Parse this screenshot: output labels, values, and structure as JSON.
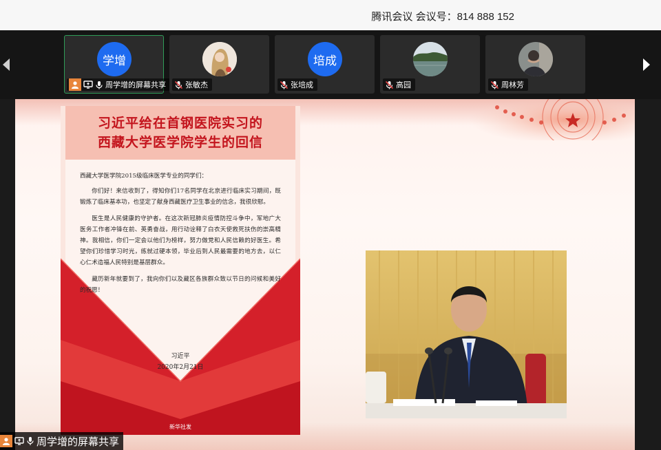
{
  "window": {
    "meeting_title": "腾讯会议 会议号：814 888 152"
  },
  "participants": [
    {
      "name": "周学增的屏幕共享",
      "avatar_text": "学增",
      "avatar_type": "initials",
      "active": true,
      "is_host": true,
      "is_sharing": true
    },
    {
      "name": "张敏杰",
      "avatar_type": "photo-portrait",
      "muted": true
    },
    {
      "name": "张培成",
      "avatar_text": "培成",
      "avatar_type": "initials",
      "muted": true
    },
    {
      "name": "高园",
      "avatar_type": "photo-landscape",
      "muted": true
    },
    {
      "name": "周林芳",
      "avatar_type": "photo-person",
      "muted": true
    }
  ],
  "share_label": "周学增的屏幕共享",
  "slide": {
    "letter": {
      "title_line1": "习近平给在首钢医院实习的",
      "title_line2": "西藏大学医学院学生的回信",
      "salutation": "西藏大学医学院2015级临床医学专业的同学们：",
      "paragraphs": [
        "你们好！来信收到了，得知你们17名同学在北京进行临床实习期间，既锻炼了临床基本功，也坚定了献身西藏医疗卫生事业的信念，我很欣慰。",
        "医生是人民健康的守护者。在这次新冠肺炎疫情防控斗争中，军地广大医务工作者冲锋在前、英勇奋战，用行动诠释了白衣天使救死扶伤的崇高精神。我相信，你们一定会以他们为榜样，努力做党和人民信赖的好医生。希望你们珍惜学习时光，练就过硬本领，毕业后到人民最需要的地方去，以仁心仁术造福人民特别是基层群众。",
        "藏历新年就要到了，我向你们以及藏区各族群众致以节日的问候和美好的祝愿！"
      ],
      "signature_name": "习近平",
      "signature_date": "2020年2月21日",
      "publisher": "新华社发"
    }
  },
  "colors": {
    "active_border": "#2f9d58",
    "avatar_blue": "#1e6bf0",
    "title_red": "#c3141d",
    "envelope_red": "#d4202a",
    "host_orange": "#e8853a"
  },
  "icons": [
    "chevron-left-icon",
    "chevron-right-icon",
    "host-icon",
    "screen-share-icon",
    "microphone-icon",
    "muted-microphone-icon",
    "national-emblem-icon",
    "xinhua-logo-icon"
  ]
}
